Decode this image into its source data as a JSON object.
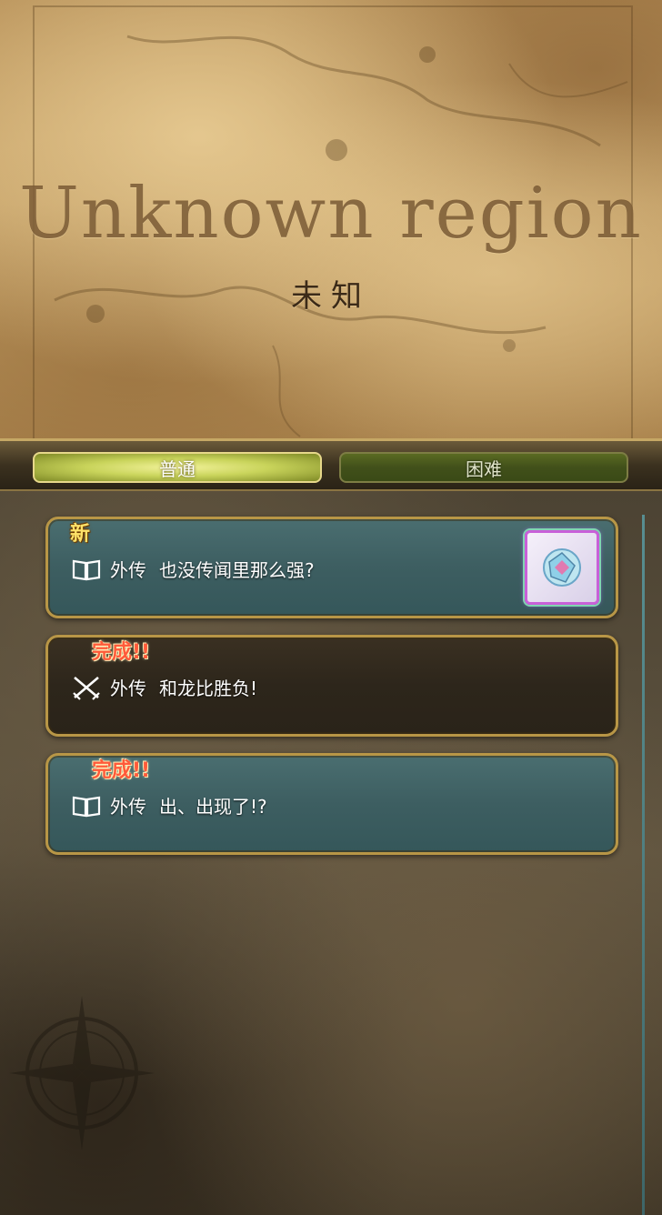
{
  "header": {
    "glyph_title": "Unknown region",
    "title": "未知"
  },
  "tabs": [
    {
      "label": "普通",
      "active": true
    },
    {
      "label": "困难",
      "active": false
    }
  ],
  "quests": [
    {
      "badge": "新",
      "icon": "book-icon",
      "type": "外传",
      "title": "也没传闻里那么强?",
      "has_reward": true,
      "style": "teal"
    },
    {
      "badge": "完成!!",
      "icon": "crossed-swords-icon",
      "type": "外传",
      "title": "和龙比胜负!",
      "has_reward": false,
      "style": "dark"
    },
    {
      "badge": "完成!!",
      "icon": "book-icon",
      "type": "外传",
      "title": "出、出现了!?",
      "has_reward": false,
      "style": "teal"
    }
  ],
  "colors": {
    "tab_active": "#c9d45b",
    "tab_inactive": "#41501a",
    "card_border": "#b89646",
    "badge_new": "#ffe36a",
    "badge_done": "#ff5a3a"
  }
}
